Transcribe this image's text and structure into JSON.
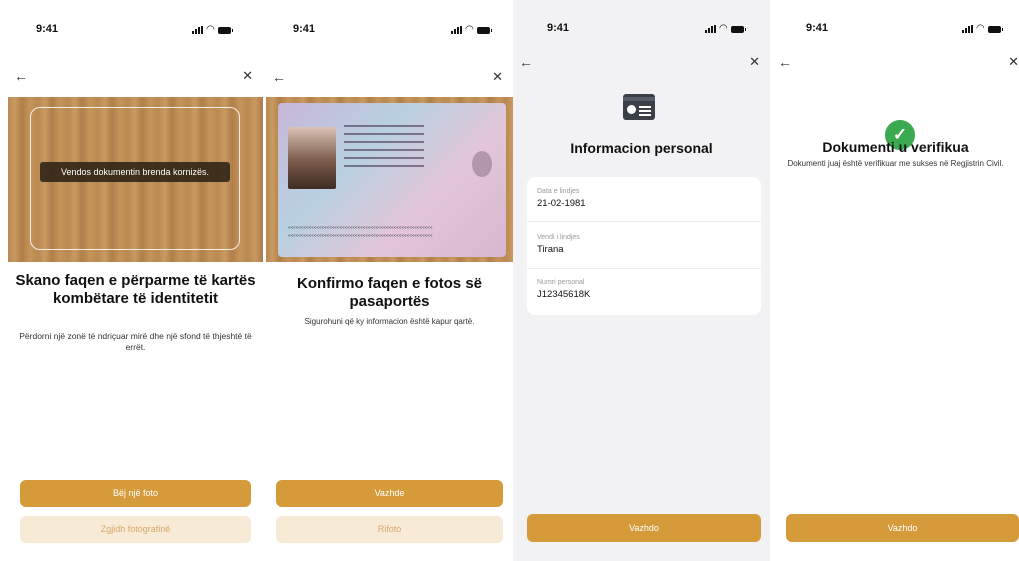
{
  "status": {
    "time": "9:41"
  },
  "nav": {
    "back_icon": "arrow-left-icon",
    "close_icon": "close-icon"
  },
  "screen1": {
    "hint": "Vendos dokumentin brenda kornizës.",
    "title": "Skano faqen e përparme të kartës kombëtare të identitetit",
    "subtitle": "Përdorni një zonë të ndriçuar mirë dhe një sfond të thjeshtë të errët.",
    "primary_button": "Bëj një foto",
    "secondary_button": "Zgjidh fotografinë"
  },
  "screen2": {
    "title": "Konfirmo faqen e fotos së pasaportës",
    "subtitle": "Sigurohuni që ky informacion është kapur qartë.",
    "primary_button": "Vazhde",
    "secondary_button": "Rifoto"
  },
  "screen3": {
    "title": "Informacion personal",
    "fields": [
      {
        "label": "Data e lindjes",
        "value": "21-02-1981"
      },
      {
        "label": "Vendi i lindjes",
        "value": "Tirana"
      },
      {
        "label": "Numri personal",
        "value": "J12345618K"
      }
    ],
    "button": "Vazhdo"
  },
  "screen4": {
    "title": "Dokumenti u verifikua",
    "subtitle": "Dokumenti juaj është verifikuar me sukses në Regjistrin Civil.",
    "button": "Vazhdo"
  },
  "colors": {
    "accent": "#d59a39",
    "accent_light": "#f7ead6",
    "success": "#3aa94f"
  }
}
